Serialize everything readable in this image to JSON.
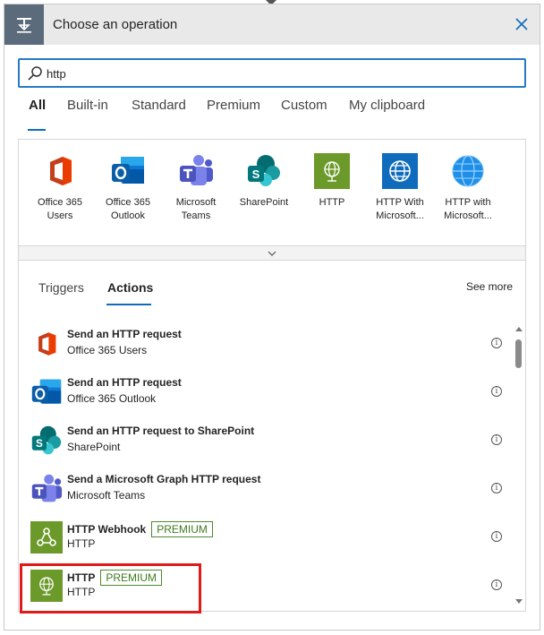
{
  "header": {
    "title": "Choose an operation",
    "icon": "connector-trigger-icon",
    "close_icon": "close-icon"
  },
  "search": {
    "value": "http",
    "placeholder": ""
  },
  "tabs": [
    {
      "label": "All",
      "active": true
    },
    {
      "label": "Built-in"
    },
    {
      "label": "Standard"
    },
    {
      "label": "Premium"
    },
    {
      "label": "Custom"
    },
    {
      "label": "My clipboard"
    }
  ],
  "connectors": [
    {
      "label": "Office 365 Users",
      "icon": "office365-icon"
    },
    {
      "label": "Office 365 Outlook",
      "icon": "outlook-icon"
    },
    {
      "label": "Microsoft Teams",
      "icon": "teams-icon"
    },
    {
      "label": "SharePoint",
      "icon": "sharepoint-icon"
    },
    {
      "label": "HTTP",
      "icon": "http-globe-icon"
    },
    {
      "label": "HTTP With Microsoft...",
      "icon": "http-with-microsoft-icon"
    },
    {
      "label": "HTTP with Microsoft...",
      "icon": "http-with-microsoft-globe-icon"
    }
  ],
  "subtabs": {
    "triggers": "Triggers",
    "actions": "Actions",
    "see_more": "See more"
  },
  "actions": [
    {
      "title": "Send an HTTP request",
      "subtitle": "Office 365 Users",
      "icon": "office365-icon",
      "badge": ""
    },
    {
      "title": "Send an HTTP request",
      "subtitle": "Office 365 Outlook",
      "icon": "outlook-icon",
      "badge": ""
    },
    {
      "title": "Send an HTTP request to SharePoint",
      "subtitle": "SharePoint",
      "icon": "sharepoint-icon",
      "badge": ""
    },
    {
      "title": "Send a Microsoft Graph HTTP request",
      "subtitle": "Microsoft Teams",
      "icon": "teams-icon",
      "badge": ""
    },
    {
      "title": "HTTP Webhook",
      "subtitle": "HTTP",
      "icon": "webhook-icon",
      "badge": "PREMIUM"
    },
    {
      "title": "HTTP",
      "subtitle": "HTTP",
      "icon": "http-globe-icon",
      "badge": "PREMIUM"
    }
  ],
  "colors": {
    "accent": "#0f6cbd",
    "search_border": "#2879c4",
    "premium_green": "#3d7a1f",
    "http_green": "#6b9a2a",
    "highlight_red": "#e01a1a"
  }
}
